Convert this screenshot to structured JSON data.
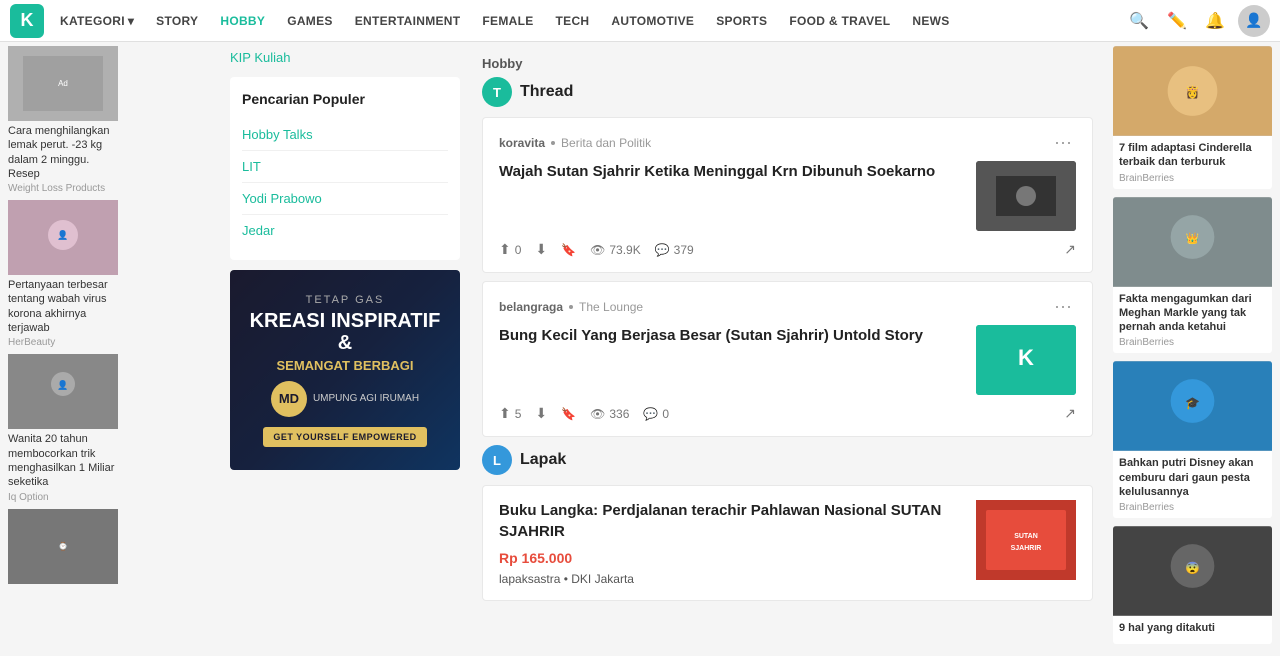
{
  "navbar": {
    "logo": "K",
    "items": [
      {
        "label": "KATEGORI",
        "hasArrow": true,
        "active": false
      },
      {
        "label": "STORY",
        "active": false
      },
      {
        "label": "HOBBY",
        "active": true
      },
      {
        "label": "GAMES",
        "active": false
      },
      {
        "label": "ENTERTAINMENT",
        "active": false
      },
      {
        "label": "FEMALE",
        "active": false
      },
      {
        "label": "TECH",
        "active": false
      },
      {
        "label": "AUTOMOTIVE",
        "active": false
      },
      {
        "label": "SPORTS",
        "active": false
      },
      {
        "label": "FOOD & TRAVEL",
        "active": false
      },
      {
        "label": "NEWS",
        "active": false
      }
    ]
  },
  "left_ads": [
    {
      "title": "Cara menghilangkan lemak perut. -23 kg dalam 2 minggu. Resep",
      "source": "Weight Loss Products",
      "thumb_color": "#aaa"
    },
    {
      "title": "Pertanyaan terbesar tentang wabah virus korona akhirnya terjawab",
      "source": "HerBeauty",
      "thumb_color": "#999"
    },
    {
      "title": "Wanita 20 tahun membocorkan trik menghasilkan 1 Miliar seketika",
      "source": "Iq Option",
      "thumb_color": "#888"
    },
    {
      "title": "",
      "source": "",
      "thumb_color": "#777"
    }
  ],
  "mid_sidebar": {
    "kip_link": "KIP Kuliah",
    "search_section": {
      "title": "Pencarian Populer",
      "items": [
        "Hobby Talks",
        "LIT",
        "Yodi Prabowo",
        "Jedar"
      ]
    },
    "banner": {
      "tetap": "TETAP GAS",
      "title1": "KREASI INSPIRATIF &",
      "title2": "SEMANGAT BERBAGI",
      "logo": "MD",
      "sub": "UMPUNG AGI IRUMAH",
      "button": "GET YOURSELF EMPOWERED"
    }
  },
  "hobby_breadcrumb": "Hobby",
  "thread_section": {
    "avatar_text": "T",
    "name": "Thread"
  },
  "posts": [
    {
      "source": "koravita",
      "category": "Berita dan Politik",
      "title": "Wajah Sutan Sjahrir Ketika Meninggal Krn Dibunuh Soekarno",
      "upvote": "0",
      "downvote": "",
      "views": "73.9K",
      "comments": "379",
      "thumb_color": "#555"
    },
    {
      "source": "belangraga",
      "category": "The Lounge",
      "title": "Bung Kecil Yang Berjasa Besar (Sutan Sjahrir) Untold Story",
      "upvote": "5",
      "downvote": "",
      "views": "336",
      "comments": "0",
      "thumb_color": "#1abc9c"
    }
  ],
  "lapak_section": {
    "avatar_text": "L",
    "name": "Lapak",
    "card": {
      "title": "Buku Langka: Perdjalanan terachir Pahlawan Nasional SUTAN SJAHRIR",
      "price": "Rp 165.000",
      "seller": "lapaksastra",
      "location": "DKI Jakarta",
      "thumb_label": "SUTAN SJAHRIR"
    }
  },
  "right_ads": [
    {
      "title": "7 film adaptasi Cinderella terbaik dan terburuk",
      "source": "BrainBerries",
      "thumb_color": "#d4a96a"
    },
    {
      "title": "Fakta mengagumkan dari Meghan Markle yang tak pernah anda ketahui",
      "source": "BrainBerries",
      "thumb_color": "#7f8c8d"
    },
    {
      "title": "Bahkan putri Disney akan cemburu dari gaun pesta kelulusannya",
      "source": "BrainBerries",
      "thumb_color": "#2980b9"
    },
    {
      "title": "9 hal yang ditakuti",
      "source": "",
      "thumb_color": "#555"
    }
  ]
}
